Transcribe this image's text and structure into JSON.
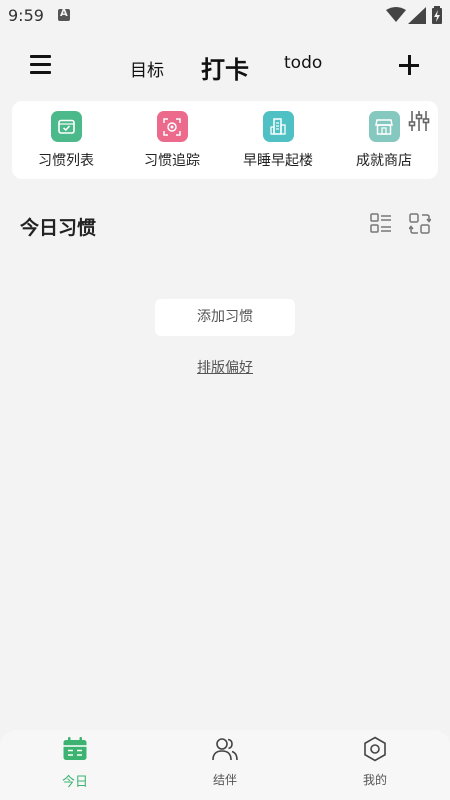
{
  "status_bar": {
    "time": "9:59",
    "icons": [
      "notification-a-icon",
      "wifi-icon",
      "signal-icon",
      "battery-charging-icon"
    ]
  },
  "top_bar": {
    "tabs": [
      {
        "label": "目标",
        "active": false
      },
      {
        "label": "打卡",
        "active": true
      },
      {
        "label": "todo",
        "active": false
      }
    ],
    "menu_icon": "hamburger-menu-icon",
    "add_icon": "plus-icon"
  },
  "shortcuts": {
    "items": [
      {
        "label": "习惯列表",
        "icon": "calendar-check-icon",
        "color": "#4cb98a"
      },
      {
        "label": "习惯追踪",
        "icon": "target-scan-icon",
        "color": "#ec6a8c"
      },
      {
        "label": "早睡早起楼",
        "icon": "building-icon",
        "color": "#4fc1c4"
      },
      {
        "label": "成就商店",
        "icon": "store-icon",
        "color": "#84c8c0"
      }
    ],
    "settings_icon": "sliders-icon"
  },
  "today": {
    "title": "今日习惯",
    "add_habit_label": "添加习惯",
    "layout_pref_label": "排版偏好"
  },
  "bottom_nav": {
    "items": [
      {
        "label": "今日",
        "icon": "calendar-icon",
        "active": true
      },
      {
        "label": "结伴",
        "icon": "users-icon",
        "active": false
      },
      {
        "label": "我的",
        "icon": "gear-icon",
        "active": false
      }
    ]
  },
  "colors": {
    "accent": "#3cb371",
    "background": "#f3f3f3",
    "card": "#ffffff"
  }
}
